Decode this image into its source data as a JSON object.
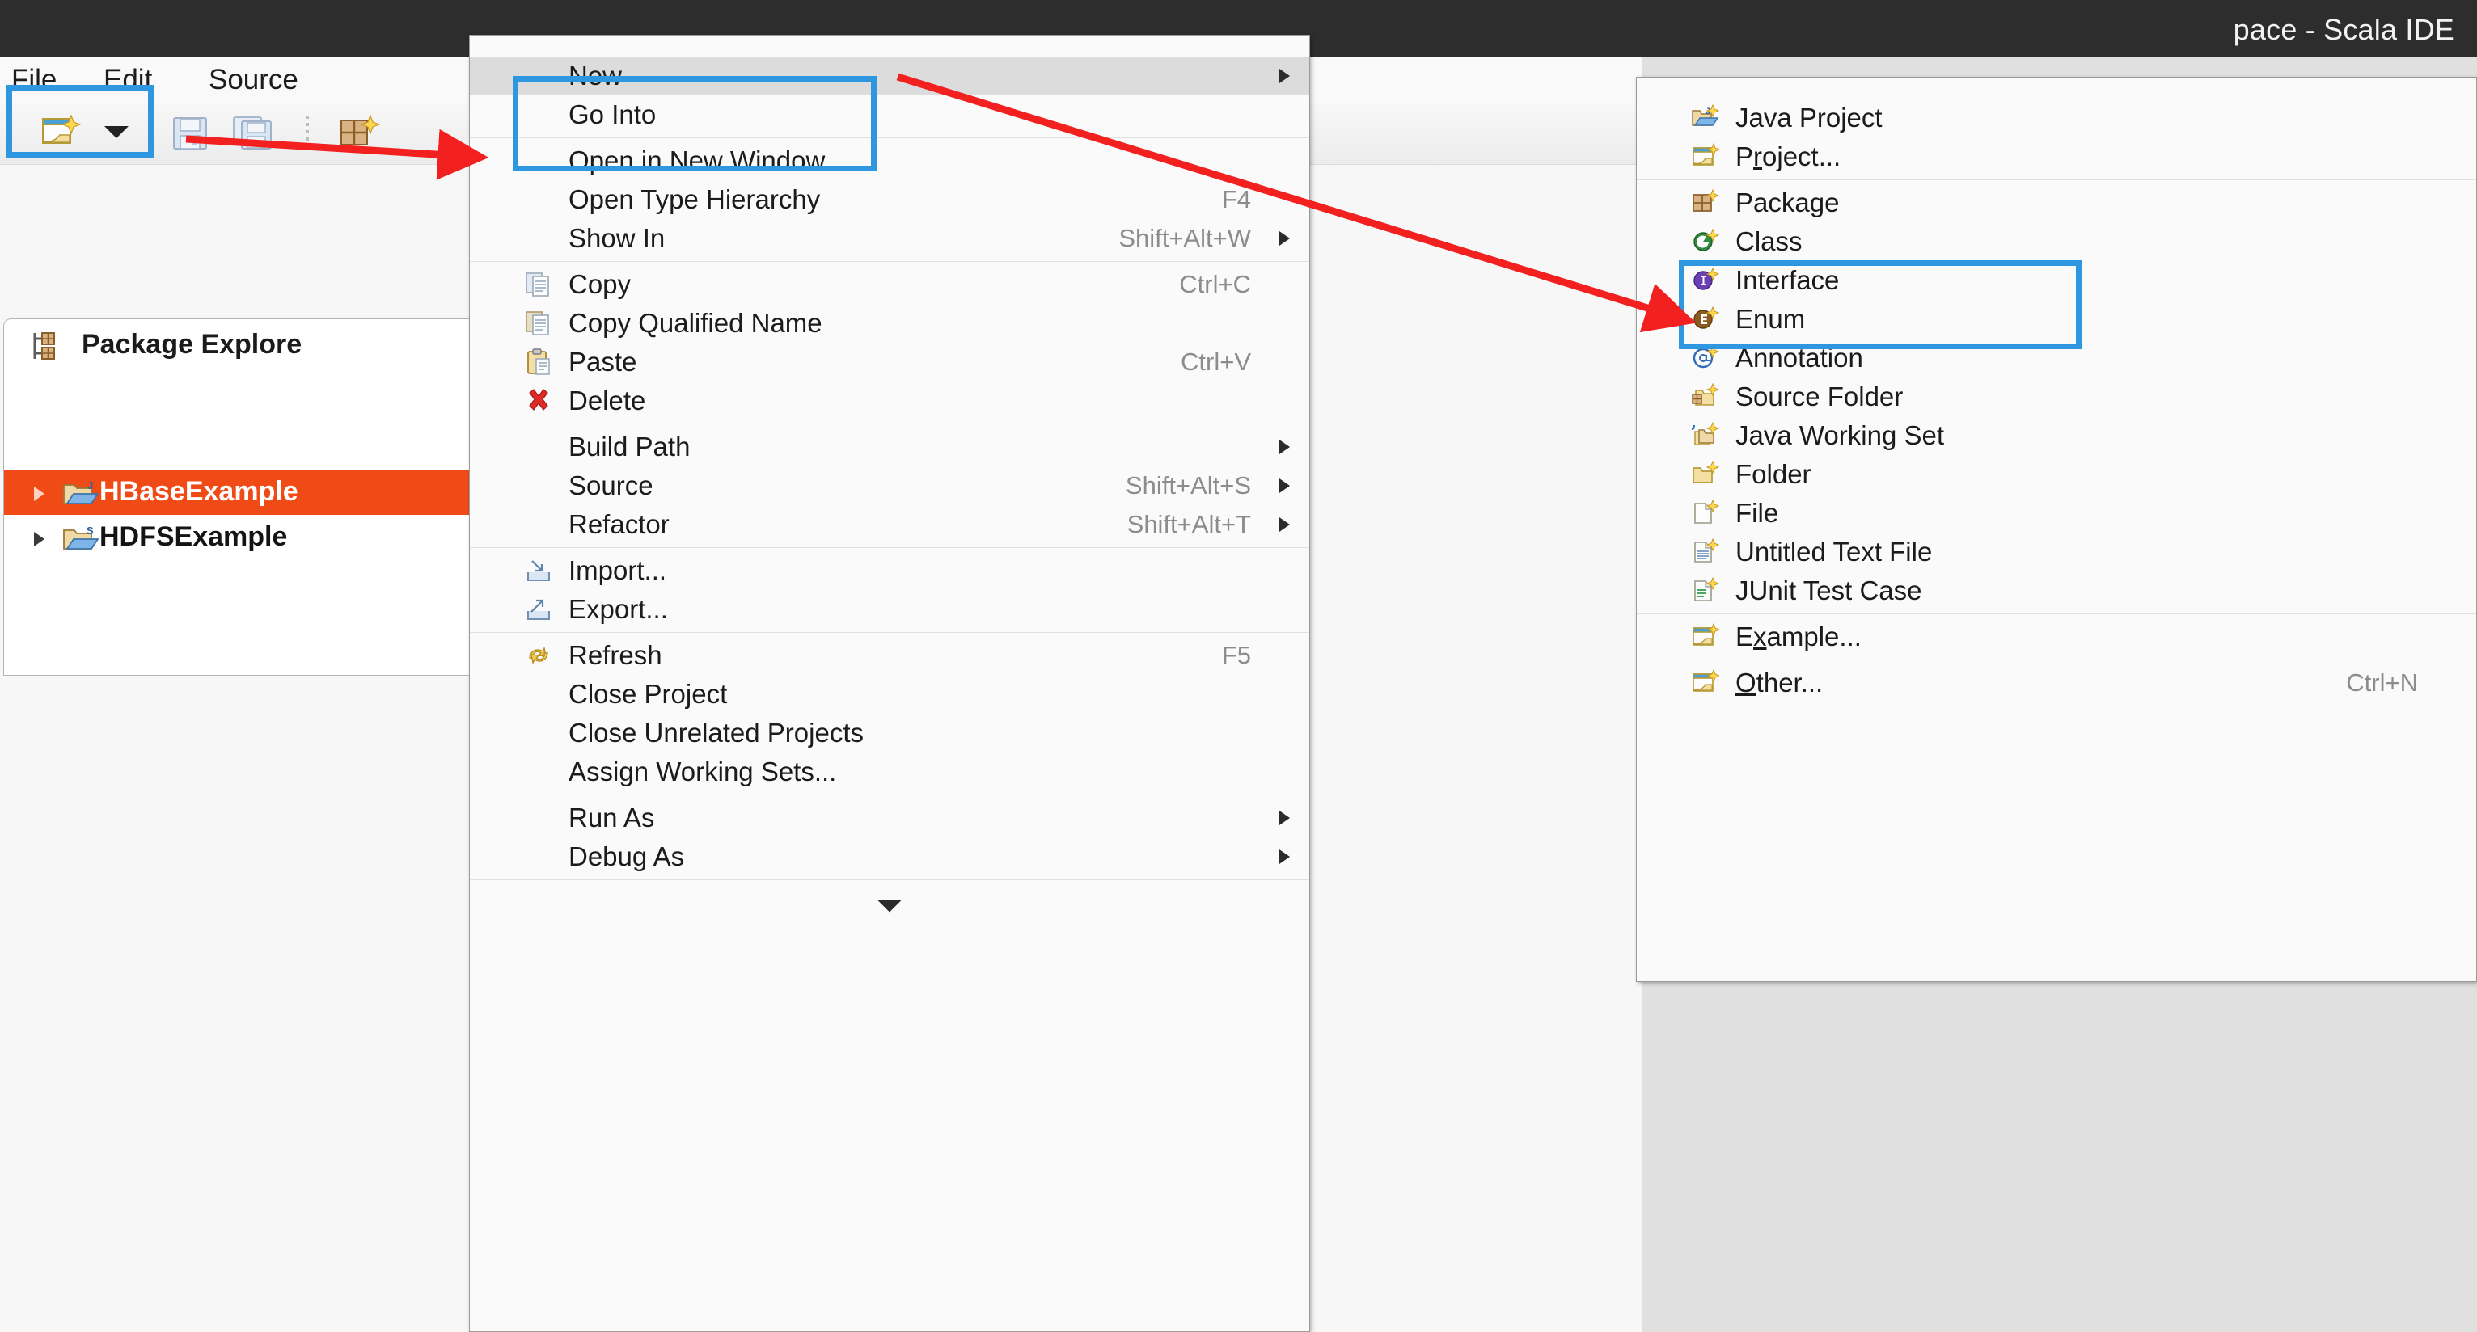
{
  "window": {
    "title": "pace - Scala IDE"
  },
  "menubar": {
    "items": [
      {
        "label": "File"
      },
      {
        "label": "Edit"
      },
      {
        "label": "Source"
      }
    ]
  },
  "toolbar": {
    "icons": [
      {
        "name": "new-wizard-icon"
      },
      {
        "name": "chevron-down-icon"
      },
      {
        "name": "save-icon"
      },
      {
        "name": "save-all-icon"
      },
      {
        "name": "new-package-icon"
      }
    ]
  },
  "package_explorer": {
    "tab_label": "Package Explore",
    "tab_icon": "package-explorer-icon",
    "tree": [
      {
        "label": "HBaseExample",
        "icon": "java-project-icon",
        "selected": true,
        "expanded": false
      },
      {
        "label": "HDFSExample",
        "icon": "scala-project-icon",
        "selected": false,
        "expanded": false
      }
    ]
  },
  "context_menu": {
    "groups": [
      {
        "items": [
          {
            "label": "New",
            "accel": "",
            "submenu": true,
            "highlighted": true,
            "icon": ""
          },
          {
            "label": "Go Into",
            "accel": "",
            "submenu": false,
            "icon": ""
          }
        ]
      },
      {
        "items": [
          {
            "label": "Open in New Window",
            "accel": "",
            "submenu": false,
            "icon": ""
          },
          {
            "label": "Open Type Hierarchy",
            "accel": "F4",
            "submenu": false,
            "icon": ""
          },
          {
            "label": "Show In",
            "accel": "Shift+Alt+W",
            "submenu": true,
            "icon": ""
          }
        ]
      },
      {
        "items": [
          {
            "label": "Copy",
            "accel": "Ctrl+C",
            "submenu": false,
            "icon": "copy-icon"
          },
          {
            "label": "Copy Qualified Name",
            "accel": "",
            "submenu": false,
            "icon": "copy-qualified-name-icon"
          },
          {
            "label": "Paste",
            "accel": "Ctrl+V",
            "submenu": false,
            "icon": "paste-icon"
          },
          {
            "label": "Delete",
            "accel": "",
            "submenu": false,
            "icon": "delete-icon"
          }
        ]
      },
      {
        "items": [
          {
            "label": "Build Path",
            "accel": "",
            "submenu": true,
            "icon": ""
          },
          {
            "label": "Source",
            "accel": "Shift+Alt+S",
            "submenu": true,
            "icon": ""
          },
          {
            "label": "Refactor",
            "accel": "Shift+Alt+T",
            "submenu": true,
            "icon": ""
          }
        ]
      },
      {
        "items": [
          {
            "label": "Import...",
            "accel": "",
            "submenu": false,
            "icon": "import-icon"
          },
          {
            "label": "Export...",
            "accel": "",
            "submenu": false,
            "icon": "export-icon"
          }
        ]
      },
      {
        "items": [
          {
            "label": "Refresh",
            "accel": "F5",
            "submenu": false,
            "icon": "refresh-icon"
          },
          {
            "label": "Close Project",
            "accel": "",
            "submenu": false,
            "icon": ""
          },
          {
            "label": "Close Unrelated Projects",
            "accel": "",
            "submenu": false,
            "icon": ""
          },
          {
            "label": "Assign Working Sets...",
            "accel": "",
            "submenu": false,
            "icon": ""
          }
        ]
      },
      {
        "items": [
          {
            "label": "Run As",
            "accel": "",
            "submenu": true,
            "icon": ""
          },
          {
            "label": "Debug As",
            "accel": "",
            "submenu": true,
            "icon": ""
          }
        ]
      }
    ],
    "scroll_down_indicator": "chevron-down-icon"
  },
  "new_submenu": {
    "groups": [
      {
        "items": [
          {
            "label": "Java Project",
            "accel": "",
            "icon": "new-java-project-icon"
          },
          {
            "label": "Project...",
            "accel": "",
            "icon": "new-project-icon",
            "mnemonic_index": 1
          }
        ]
      },
      {
        "items": [
          {
            "label": "Package",
            "accel": "",
            "icon": "new-package-icon"
          },
          {
            "label": "Class",
            "accel": "",
            "icon": "new-class-icon",
            "boxed": true
          },
          {
            "label": "Interface",
            "accel": "",
            "icon": "new-interface-icon"
          },
          {
            "label": "Enum",
            "accel": "",
            "icon": "new-enum-icon"
          },
          {
            "label": "Annotation",
            "accel": "",
            "icon": "new-annotation-icon"
          },
          {
            "label": "Source Folder",
            "accel": "",
            "icon": "new-source-folder-icon"
          },
          {
            "label": "Java Working Set",
            "accel": "",
            "icon": "new-java-working-set-icon"
          },
          {
            "label": "Folder",
            "accel": "",
            "icon": "new-folder-icon"
          },
          {
            "label": "File",
            "accel": "",
            "icon": "new-file-icon"
          },
          {
            "label": "Untitled Text File",
            "accel": "",
            "icon": "new-untitled-text-file-icon"
          },
          {
            "label": "JUnit Test Case",
            "accel": "",
            "icon": "new-junit-test-case-icon"
          }
        ]
      },
      {
        "items": [
          {
            "label": "Example...",
            "accel": "",
            "icon": "new-example-icon",
            "mnemonic_index": 1
          }
        ]
      },
      {
        "items": [
          {
            "label": "Other...",
            "accel": "Ctrl+N",
            "icon": "new-other-icon",
            "mnemonic_index": 0
          }
        ]
      }
    ]
  },
  "annotations": {
    "highlight_color": "#2f96e0",
    "arrow_color": "#f32020",
    "boxes": [
      {
        "name": "file-menu-highlight"
      },
      {
        "name": "new-item-highlight"
      },
      {
        "name": "class-item-highlight"
      }
    ],
    "arrows": [
      {
        "name": "arrow-to-file-menu"
      },
      {
        "name": "arrow-to-class-item"
      }
    ]
  }
}
